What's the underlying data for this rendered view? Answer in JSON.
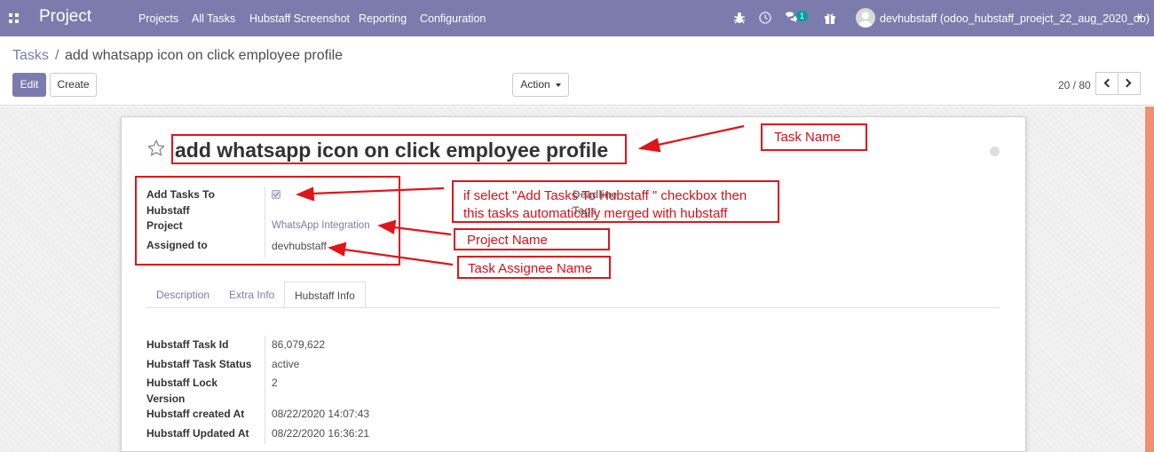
{
  "navbar": {
    "app_name": "Project",
    "menu": [
      "Projects",
      "All Tasks",
      "Hubstaff Screenshot",
      "Reporting",
      "Configuration"
    ],
    "chat_count": "1",
    "user": "devhubstaff (odoo_hubstaff_proejct_22_aug_2020_db)",
    "icons": [
      "apps-icon",
      "bug-icon",
      "clock-icon",
      "chat-icon",
      "gift-icon",
      "avatar",
      "caret-down-icon"
    ],
    "bg_color": "#7c7bad"
  },
  "breadcrumb": {
    "parent": "Tasks",
    "separator": "/",
    "current": "add whatsapp icon on click employee profile"
  },
  "buttons": {
    "edit": "Edit",
    "create": "Create",
    "action": "Action"
  },
  "pager": {
    "value": "20 / 80"
  },
  "task": {
    "name": "add whatsapp icon on click employee profile",
    "fields": {
      "add_to_hubstaff_label_line1": "Add Tasks To",
      "add_to_hubstaff_label_line2": "Hubstaff",
      "project_label": "Project",
      "project_value": "WhatsApp Integration",
      "assigned_label": "Assigned to",
      "assigned_value": "devhubstaff",
      "deadline_label": "Deadline",
      "tags_label": "Tags"
    }
  },
  "tabs": [
    "Description",
    "Extra Info",
    "Hubstaff Info"
  ],
  "active_tab": "Hubstaff Info",
  "hubstaff_info": [
    {
      "label": "Hubstaff Task Id",
      "value": "86,079,622"
    },
    {
      "label": "Hubstaff Task Status",
      "value": "active"
    },
    {
      "label": "Hubstaff Lock",
      "label2": "Version",
      "value": "2"
    },
    {
      "label": "Hubstaff created At",
      "value": "08/22/2020 14:07:43"
    },
    {
      "label": "Hubstaff Updated At",
      "value": "08/22/2020 16:36:21"
    }
  ],
  "annotations": {
    "task_name": "Task Name",
    "checkbox_note_line1": "if select \"Add Tasks To Hubstaff \" checkbox then",
    "checkbox_note_line2": "this tasks automatically merged with hubstaff",
    "project_name": "Project Name",
    "assignee_name": "Task Assignee Name",
    "color": "#e0141b"
  }
}
